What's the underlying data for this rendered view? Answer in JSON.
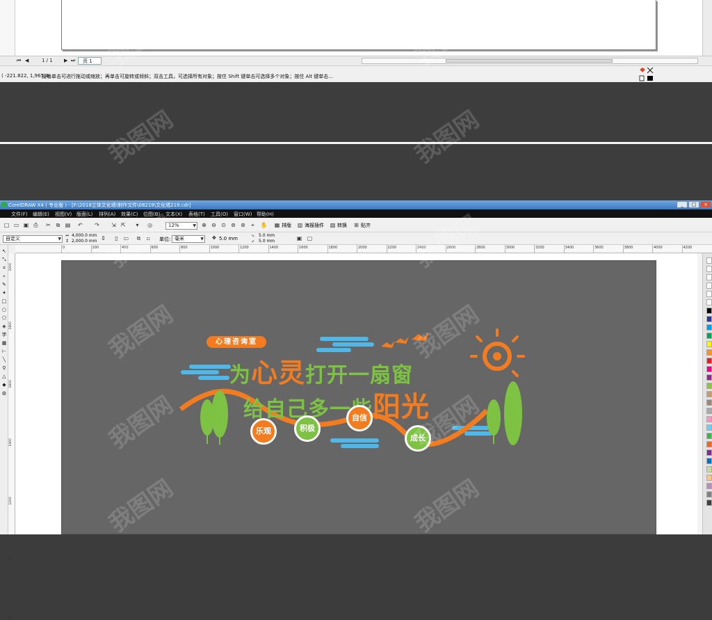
{
  "top_window": {
    "navigator": {
      "page_count": "1 / 1",
      "page_tab": "页 1"
    },
    "status": {
      "coords": "( -221.822, 1,965.4...",
      "hint": "接着单击可进行拖动或缩放；再单击可旋转或倾斜；双击工具，可选择所有对象；按住 Shift 键单击可选择多个对象；按住 Alt 键单击..."
    }
  },
  "window": {
    "title": "CorelDRAW X4 ( 专业版 ) - [F:\\2018立体文化墙\\制作文件\\08219\\文化墙219.cdr]",
    "controls": {
      "minimize": "_",
      "maximize": "□",
      "close": "×"
    }
  },
  "menu": [
    "文件(F)",
    "编辑(E)",
    "视图(V)",
    "版面(L)",
    "排列(A)",
    "效果(C)",
    "位图(B)",
    "文本(X)",
    "表格(T)",
    "工具(O)",
    "窗口(W)",
    "帮助(H)"
  ],
  "standard_toolbar": {
    "zoom": "12%",
    "buttons": [
      "排版",
      "海报插件",
      "转换",
      "贴齐"
    ]
  },
  "property_bar": {
    "paper": "自定义",
    "width": "4,000.0 mm",
    "height": "2,000.0 mm",
    "unit_label": "单位:",
    "unit": "毫米",
    "nudge": "5.0 mm",
    "dup_x": "5.0 mm",
    "dup_y": "5.0 mm"
  },
  "ruler_h": [
    "0",
    "200",
    "400",
    "600",
    "800",
    "1000",
    "1200",
    "1400",
    "1600",
    "1800",
    "2000",
    "2200",
    "2400",
    "2600",
    "2800",
    "3000",
    "3200",
    "3400",
    "3600",
    "3800",
    "4000",
    "4200"
  ],
  "ruler_v": [
    "2000",
    "1800",
    "1600",
    "1400",
    "1200",
    "1000",
    "800"
  ],
  "design": {
    "room_label": "心理咨询室",
    "line1_prefix": "为",
    "line1_big": "心灵",
    "line1_suffix": "打开一扇窗",
    "line2_prefix": "给自己多一些",
    "line2_big": "阳光",
    "badges": [
      "乐观",
      "积极",
      "自信",
      "成长"
    ]
  },
  "watermark": "我图网",
  "colors": {
    "orange": "#f47c20",
    "green": "#7dc242",
    "sky_blue": "#4fb8e8",
    "artboard": "#666666"
  }
}
